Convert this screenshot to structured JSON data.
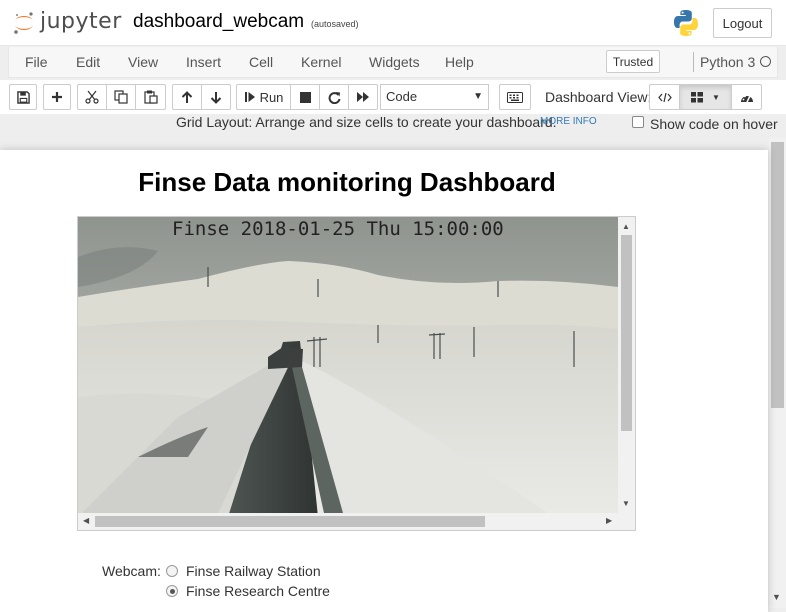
{
  "header": {
    "logo_text": "jupyter",
    "notebook_name": "dashboard_webcam",
    "autosave": "(autosaved)",
    "logout": "Logout"
  },
  "menubar": {
    "items": [
      "File",
      "Edit",
      "View",
      "Insert",
      "Cell",
      "Kernel",
      "Widgets",
      "Help"
    ],
    "trusted": "Trusted",
    "kernel": "Python 3"
  },
  "toolbar": {
    "run_label": "Run",
    "cell_type": "Code",
    "dashboard_view_label": "Dashboard View:"
  },
  "grid_info": {
    "text": "Grid Layout: Arrange and size cells to create your dashboard.",
    "more_info": "MORE INFO",
    "show_code": "Show code on hover",
    "show_code_checked": false
  },
  "dashboard": {
    "title": "Finse Data monitoring Dashboard",
    "webcam_stamp": "Finse 2018-01-25 Thu 15:00:00",
    "radio_label": "Webcam:",
    "options": [
      {
        "label": "Finse Railway Station",
        "selected": false
      },
      {
        "label": "Finse Research Centre",
        "selected": true
      }
    ]
  },
  "colors": {
    "accent_orange": "#F37726",
    "link_blue": "#337ab7"
  }
}
